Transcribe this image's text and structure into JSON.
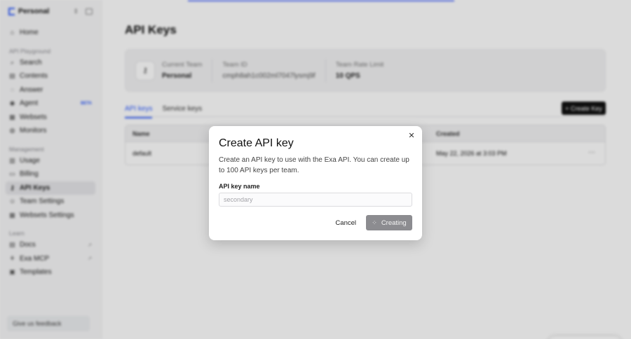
{
  "sidebar": {
    "team_name": "Personal",
    "nav_top": [
      {
        "label": "Home",
        "icon": "home-icon"
      }
    ],
    "section_playground": "API Playground",
    "playground_items": [
      {
        "label": "Search",
        "icon": "search-icon"
      },
      {
        "label": "Contents",
        "icon": "document-icon"
      },
      {
        "label": "Answer",
        "icon": "chat-icon"
      },
      {
        "label": "Agent",
        "icon": "agent-icon",
        "badge": "BETA"
      },
      {
        "label": "Websets",
        "icon": "grid-icon"
      },
      {
        "label": "Monitors",
        "icon": "monitor-icon"
      }
    ],
    "section_management": "Management",
    "management_items": [
      {
        "label": "Usage",
        "icon": "chart-icon"
      },
      {
        "label": "Billing",
        "icon": "card-icon"
      },
      {
        "label": "API Keys",
        "icon": "key-icon",
        "active": true
      },
      {
        "label": "Team Settings",
        "icon": "users-icon"
      },
      {
        "label": "Websets Settings",
        "icon": "settings-icon"
      }
    ],
    "section_learn": "Learn",
    "learn_items": [
      {
        "label": "Docs",
        "icon": "book-icon",
        "external": true
      },
      {
        "label": "Exa MCP",
        "icon": "mcp-icon",
        "external": true
      },
      {
        "label": "Templates",
        "icon": "template-icon"
      }
    ],
    "feedback_label": "Give us feedback"
  },
  "main": {
    "title": "API Keys",
    "team_card": {
      "current_team_label": "Current Team",
      "current_team_value": "Personal",
      "team_id_label": "Team ID",
      "team_id_value": "cmph8ah1c002ml7047lysmj9f",
      "rate_limit_label": "Team Rate Limit",
      "rate_limit_value": "10 QPS"
    },
    "tabs": [
      {
        "label": "API keys",
        "active": true
      },
      {
        "label": "Service keys",
        "active": false
      }
    ],
    "create_key_label": "+ Create Key",
    "table": {
      "columns": [
        "Name",
        "Created"
      ],
      "rows": [
        {
          "name": "default",
          "created": "May 22, 2026 at 3:03 PM",
          "more": "···"
        }
      ]
    }
  },
  "modal": {
    "title": "Create API key",
    "description": "Create an API key to use with the Exa API. You can create up to 100 API keys per team.",
    "field_label": "API key name",
    "field_placeholder": "secondary",
    "field_value": "",
    "cancel_label": "Cancel",
    "submit_label": "Creating"
  },
  "colors": {
    "accent": "#2d5bff",
    "primary_button": "#111111",
    "disabled_button": "#8c8c90"
  }
}
